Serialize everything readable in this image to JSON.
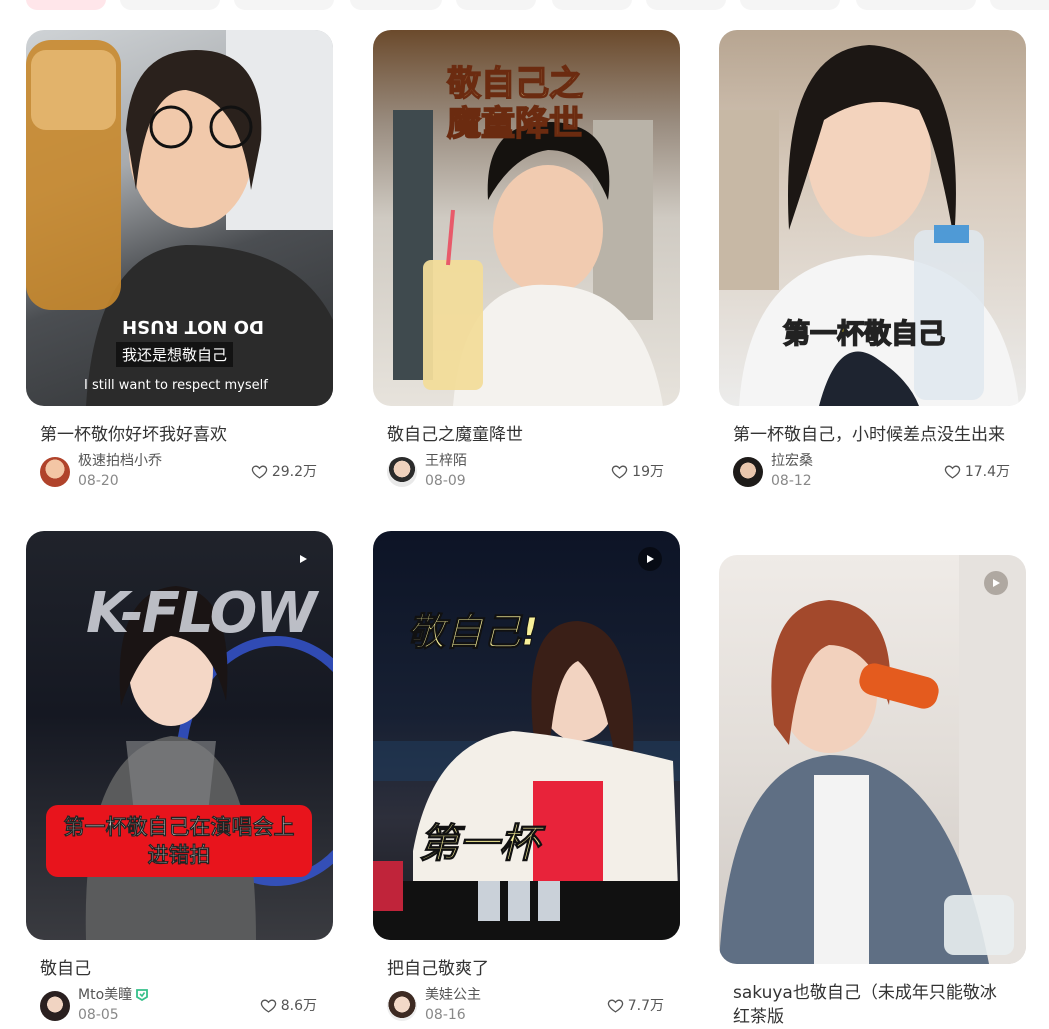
{
  "colors": {
    "accent": "#ff2442",
    "text": "#333333",
    "muted": "#888888"
  },
  "icons": {
    "play": "play-icon",
    "like": "heart-outline-icon"
  },
  "feed": [
    {
      "title": "第一杯敬你好坏我好喜欢",
      "author": "极速拍档小乔",
      "date": "08-20",
      "likes": "29.2万",
      "caption_cn": "我还是想敬自己",
      "caption_en": "I still want to respect myself",
      "shirt": "DO NOT RUSH"
    },
    {
      "title": "敬自己之魔童降世",
      "author": "王梓陌",
      "date": "08-09",
      "likes": "19万",
      "overlay": "敬自己之\n魔童降世"
    },
    {
      "title": "第一杯敬自己，小时候差点没生出来",
      "author": "拉宏桑",
      "date": "08-12",
      "likes": "17.4万",
      "overlay": "第一杯敬自己"
    },
    {
      "title": "敬自己",
      "author": "Mto美瞳",
      "date": "08-05",
      "likes": "8.6万",
      "overlay": "第一杯敬自己在演唱会上\n进错拍",
      "backdrop": "K-FLOW"
    },
    {
      "title": "把自己敬爽了",
      "author": "美娃公主",
      "date": "08-16",
      "likes": "7.7万",
      "overlay_top": "敬自己!",
      "overlay_mid": "第一杯"
    },
    {
      "title": "sakuya也敬自己（未成年只能敬冰红茶版"
    }
  ]
}
